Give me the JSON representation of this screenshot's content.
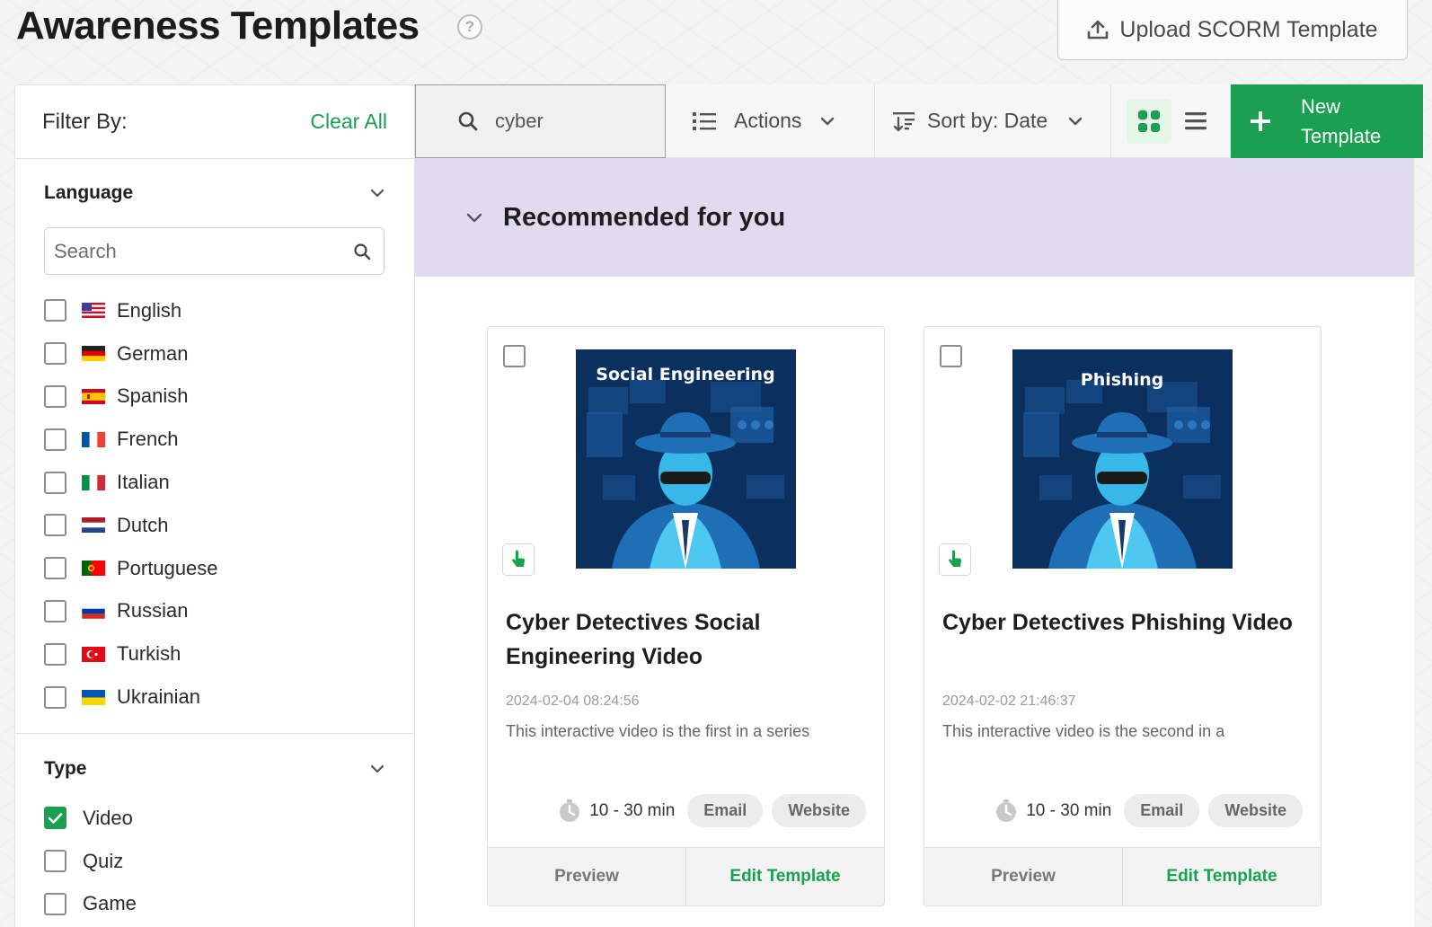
{
  "page": {
    "title": "Awareness Templates",
    "help": "?"
  },
  "upload_button": {
    "label": "Upload SCORM Template"
  },
  "filter": {
    "title": "Filter By:",
    "clear_all": "Clear All",
    "language": {
      "title": "Language",
      "search_placeholder": "Search",
      "items": [
        {
          "label": "English",
          "flag": "us-flag-icon"
        },
        {
          "label": "German",
          "flag": "de-flag-icon"
        },
        {
          "label": "Spanish",
          "flag": "es-flag-icon"
        },
        {
          "label": "French",
          "flag": "fr-flag-icon"
        },
        {
          "label": "Italian",
          "flag": "it-flag-icon"
        },
        {
          "label": "Dutch",
          "flag": "nl-flag-icon"
        },
        {
          "label": "Portuguese",
          "flag": "pt-flag-icon"
        },
        {
          "label": "Russian",
          "flag": "ru-flag-icon"
        },
        {
          "label": "Turkish",
          "flag": "tr-flag-icon"
        },
        {
          "label": "Ukrainian",
          "flag": "ua-flag-icon"
        }
      ]
    },
    "type": {
      "title": "Type",
      "items": [
        {
          "label": "Video",
          "checked": true
        },
        {
          "label": "Quiz",
          "checked": false
        },
        {
          "label": "Game",
          "checked": false
        }
      ]
    }
  },
  "toolbar": {
    "search_value": "cyber",
    "actions": "Actions",
    "sort": "Sort by: Date",
    "new_line1": "New",
    "new_line2": "Template"
  },
  "recommended": {
    "title": "Recommended for you"
  },
  "cards": [
    {
      "thumb_text": "Social Engineering",
      "title": "Cyber Detectives Social Engineering Video",
      "date": "2024-02-04 08:24:56",
      "desc": "This interactive video is the first in a series",
      "duration": "10 - 30 min",
      "tags": [
        "Email",
        "Website"
      ],
      "preview": "Preview",
      "edit": "Edit Template"
    },
    {
      "thumb_text": "Phishing",
      "title": "Cyber Detectives Phishing Video",
      "date": "2024-02-02 21:46:37",
      "desc": "This interactive video is the second in a",
      "duration": "10 - 30 min",
      "tags": [
        "Email",
        "Website"
      ],
      "preview": "Preview",
      "edit": "Edit Template"
    }
  ],
  "colors": {
    "accent": "#1aa050",
    "recommended_bg": "#e2dbf0",
    "thumb_bg": "#0b2f5e"
  }
}
